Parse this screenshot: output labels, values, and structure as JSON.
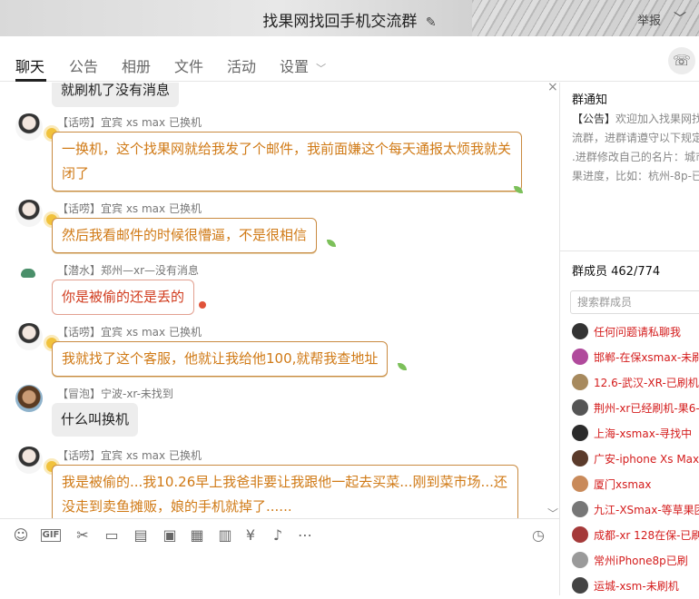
{
  "titlebar": {
    "title": "找果网找回手机交流群",
    "edit_icon": "✎",
    "report_label": "举报",
    "chevron": "﹀"
  },
  "tabs": [
    {
      "label": "聊天"
    },
    {
      "label": "公告"
    },
    {
      "label": "相册"
    },
    {
      "label": "文件"
    },
    {
      "label": "活动"
    },
    {
      "label": "设置"
    }
  ],
  "settings_chevron": "﹀",
  "call_icon": "☏",
  "chat": {
    "partial_top": "就刷机了没有消息",
    "messages": [
      {
        "meta": "【话唠】宜宾 xs max 已换机",
        "text": "一换机，这个找果网就给我发了个邮件，我前面嫌这个每天通报太烦我就关闭了"
      },
      {
        "meta": "【话唠】宜宾 xs max 已换机",
        "text": "然后我看邮件的时候很懵逼，不是很相信"
      },
      {
        "meta": "【潜水】郑州—xr—没有消息",
        "text": "你是被偷的还是丢的"
      },
      {
        "meta": "【话唠】宜宾 xs max 已换机",
        "text": "我就找了这个客服，他就让我给他100,就帮我查地址"
      },
      {
        "meta": "【冒泡】宁波-xr-未找到",
        "text": "什么叫换机"
      },
      {
        "meta": "【话唠】宜宾 xs max 已换机",
        "text": "我是被偷的...我10.26早上我爸非要让我跟他一起去买菜...刚到菜市场...还没走到卖鱼摊贩，娘的手机就掉了......"
      }
    ],
    "close_glyph": "×",
    "scroll_glyph": "﹀"
  },
  "toolbar": {
    "emoji": "☺",
    "gif": "GIF",
    "cut": "✂",
    "folder": "▭",
    "doc": "▤",
    "image": "▣",
    "card": "▦",
    "gift": "▥",
    "red_packet": "¥",
    "bell": "♪",
    "more": "⋯",
    "history": "◷"
  },
  "side": {
    "notice_title": "群通知",
    "notice_tag": "【公告】",
    "notice_lines": [
      "欢迎加入找果网找回",
      "流群，进群请遵守以下规定",
      ".进群修改自己的名片：城市",
      "果进度，比如：杭州-8p-已"
    ],
    "members_title": "群成员 462/774",
    "search_placeholder": "搜索群成员",
    "members": [
      {
        "name": "任何问题请私聊我",
        "color": "#333"
      },
      {
        "name": "邯郸-在保xsmax-未刷",
        "color": "#b04a9c"
      },
      {
        "name": "12.6-武汉-XR-已刷机",
        "color": "#a78a5e"
      },
      {
        "name": "荆州-xr已经刷机-果6-",
        "color": "#555"
      },
      {
        "name": "上海-xsmax-寻找中",
        "color": "#2b2b2b"
      },
      {
        "name": "广安-iphone Xs Max",
        "color": "#5b3b2b"
      },
      {
        "name": "厦门xsmax",
        "color": "#c98a5a"
      },
      {
        "name": "九江-XSmax-等草果团",
        "color": "#777"
      },
      {
        "name": "成都-xr 128在保-已刷",
        "color": "#a53a3a"
      },
      {
        "name": "常州iPhone8p已刷",
        "color": "#9a9a9a"
      },
      {
        "name": "运城-xsm-未刷机",
        "color": "#444"
      }
    ]
  }
}
